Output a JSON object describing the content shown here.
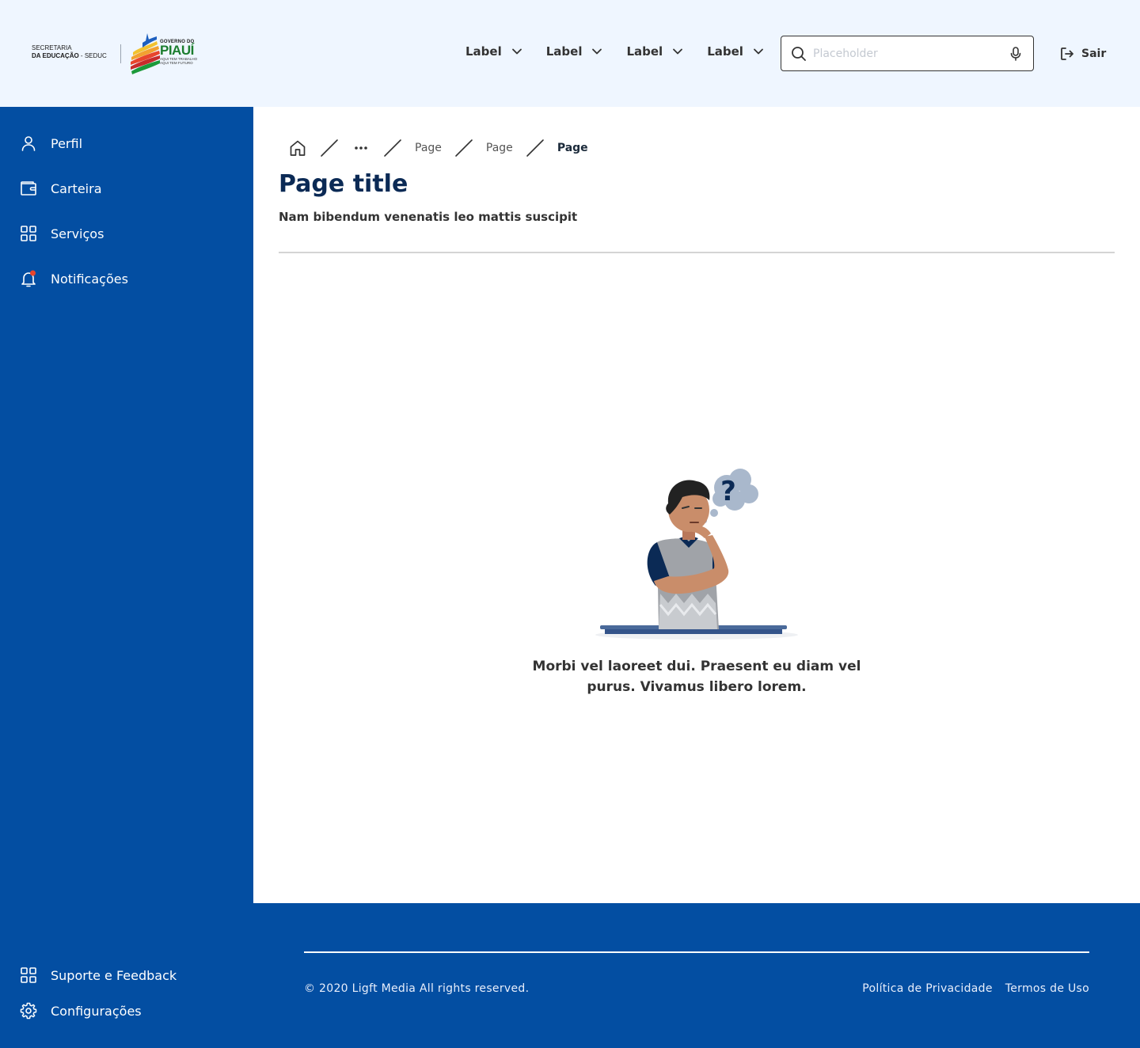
{
  "header": {
    "logo": {
      "secretaria_line1": "SECRETARIA",
      "secretaria_line2_bold": "DA EDUCAÇÃO",
      "secretaria_line2_rest": " - SEDUC",
      "gov_line1": "GOVERNO DO",
      "gov_line2": "PIAUÍ",
      "gov_line3": "AQUI TEM TRABALHO",
      "gov_line4": "AQUI TEM FUTURO"
    },
    "nav": [
      {
        "label": "Label",
        "icon": "chevron-down-icon"
      },
      {
        "label": "Label",
        "icon": "chevron-down-icon"
      },
      {
        "label": "Label",
        "icon": "chevron-down-icon"
      },
      {
        "label": "Label",
        "icon": "chevron-down-icon"
      }
    ],
    "search": {
      "placeholder": "Placeholder",
      "value": ""
    },
    "logout_label": "Sair"
  },
  "sidebar": {
    "items": [
      {
        "label": "Perfil",
        "icon": "user-icon"
      },
      {
        "label": "Carteira",
        "icon": "wallet-icon"
      },
      {
        "label": "Serviços",
        "icon": "grid-icon"
      },
      {
        "label": "Notificações",
        "icon": "bell-icon"
      }
    ],
    "bottom_items": [
      {
        "label": "Suporte e Feedback",
        "icon": "grid-icon"
      },
      {
        "label": "Configurações",
        "icon": "gear-icon"
      }
    ]
  },
  "breadcrumb": {
    "items": [
      "Page",
      "Page"
    ],
    "current": "Page"
  },
  "main": {
    "title": "Page title",
    "subtitle": "Nam bibendum venenatis leo mattis suscipit",
    "empty_message": "Morbi vel laoreet dui. Praesent eu diam vel purus. Vivamus libero lorem."
  },
  "footer": {
    "copyright": "© 2020 Ligft Media All rights reserved.",
    "links": [
      "Política de Privacidade",
      "Termos de Uso"
    ]
  },
  "colors": {
    "primary": "#034ea2",
    "header_bg": "#eff6ff",
    "title": "#0b2a55",
    "notification_dot": "#e8452c"
  }
}
